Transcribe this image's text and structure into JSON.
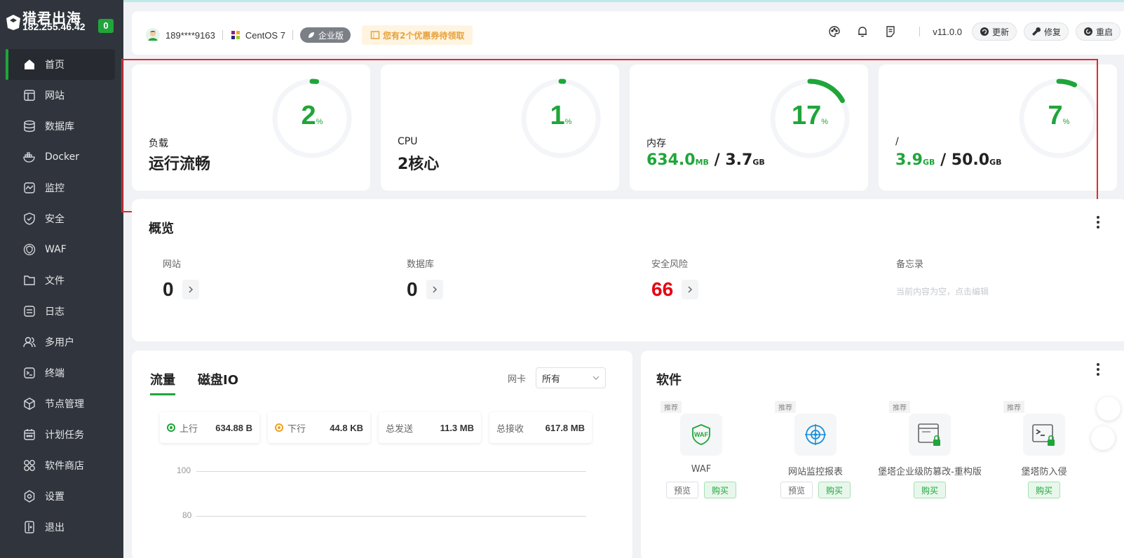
{
  "brand": {
    "name": "猎君出海",
    "ip": "182.255.46.42",
    "badge": "0"
  },
  "nav": [
    {
      "key": "home",
      "label": "首页",
      "active": true
    },
    {
      "key": "website",
      "label": "网站"
    },
    {
      "key": "database",
      "label": "数据库"
    },
    {
      "key": "docker",
      "label": "Docker"
    },
    {
      "key": "monitor",
      "label": "监控"
    },
    {
      "key": "security",
      "label": "安全"
    },
    {
      "key": "waf",
      "label": "WAF"
    },
    {
      "key": "files",
      "label": "文件"
    },
    {
      "key": "logs",
      "label": "日志"
    },
    {
      "key": "users",
      "label": "多用户"
    },
    {
      "key": "terminal",
      "label": "终端"
    },
    {
      "key": "nodes",
      "label": "节点管理"
    },
    {
      "key": "cron",
      "label": "计划任务"
    },
    {
      "key": "store",
      "label": "软件商店"
    },
    {
      "key": "settings",
      "label": "设置"
    },
    {
      "key": "logout",
      "label": "退出"
    }
  ],
  "header": {
    "user": "189****9163",
    "os": "CentOS 7",
    "edition": "企业版",
    "coupon": "您有2个优惠券待领取",
    "version": "v11.0.0",
    "update_label": "更新",
    "repair_label": "修复",
    "restart_label": "重启"
  },
  "stats": {
    "load": {
      "label": "负载",
      "value": "运行流畅",
      "percent": 2
    },
    "cpu": {
      "label": "CPU",
      "value": "2核心",
      "percent": 1
    },
    "memory": {
      "label": "内存",
      "used": "634.0",
      "used_unit": "MB",
      "total": "3.7",
      "total_unit": "GB",
      "percent": 17
    },
    "disk": {
      "label": "/",
      "used": "3.9",
      "used_unit": "GB",
      "total": "50.0",
      "total_unit": "GB",
      "percent": 7
    },
    "percent_unit": "%",
    "separator": "/"
  },
  "overview": {
    "title": "概览",
    "website": {
      "label": "网站",
      "value": "0"
    },
    "database": {
      "label": "数据库",
      "value": "0"
    },
    "risk": {
      "label": "安全风险",
      "value": "66"
    },
    "memo": {
      "label": "备忘录",
      "placeholder": "当前内容为空，点击编辑"
    }
  },
  "traffic": {
    "tabs": [
      "流量",
      "磁盘IO"
    ],
    "nic_label": "网卡",
    "nic_value": "所有",
    "up_label": "上行",
    "up_value": "634.88 B",
    "down_label": "下行",
    "down_value": "44.8 KB",
    "sent_label": "总发送",
    "sent_value": "11.3 MB",
    "recv_label": "总接收",
    "recv_value": "617.8 MB",
    "y_ticks": [
      "100",
      "80"
    ]
  },
  "software": {
    "title": "软件",
    "tag": "推荐",
    "preview_label": "预览",
    "buy_label": "购买",
    "items": [
      {
        "name": "WAF",
        "icon": "waf-shield-icon",
        "preview": true
      },
      {
        "name": "网站监控报表",
        "icon": "monitor-report-icon",
        "preview": true
      },
      {
        "name": "堡塔企业级防篡改-重构版",
        "icon": "tamper-proof-icon",
        "preview": false
      },
      {
        "name": "堡塔防入侵",
        "icon": "intrusion-prevention-icon",
        "preview": false
      }
    ]
  },
  "colors": {
    "accent": "#20a53a",
    "sidebar": "#30353d",
    "danger": "#e60012",
    "highlight": "#e8262a"
  }
}
